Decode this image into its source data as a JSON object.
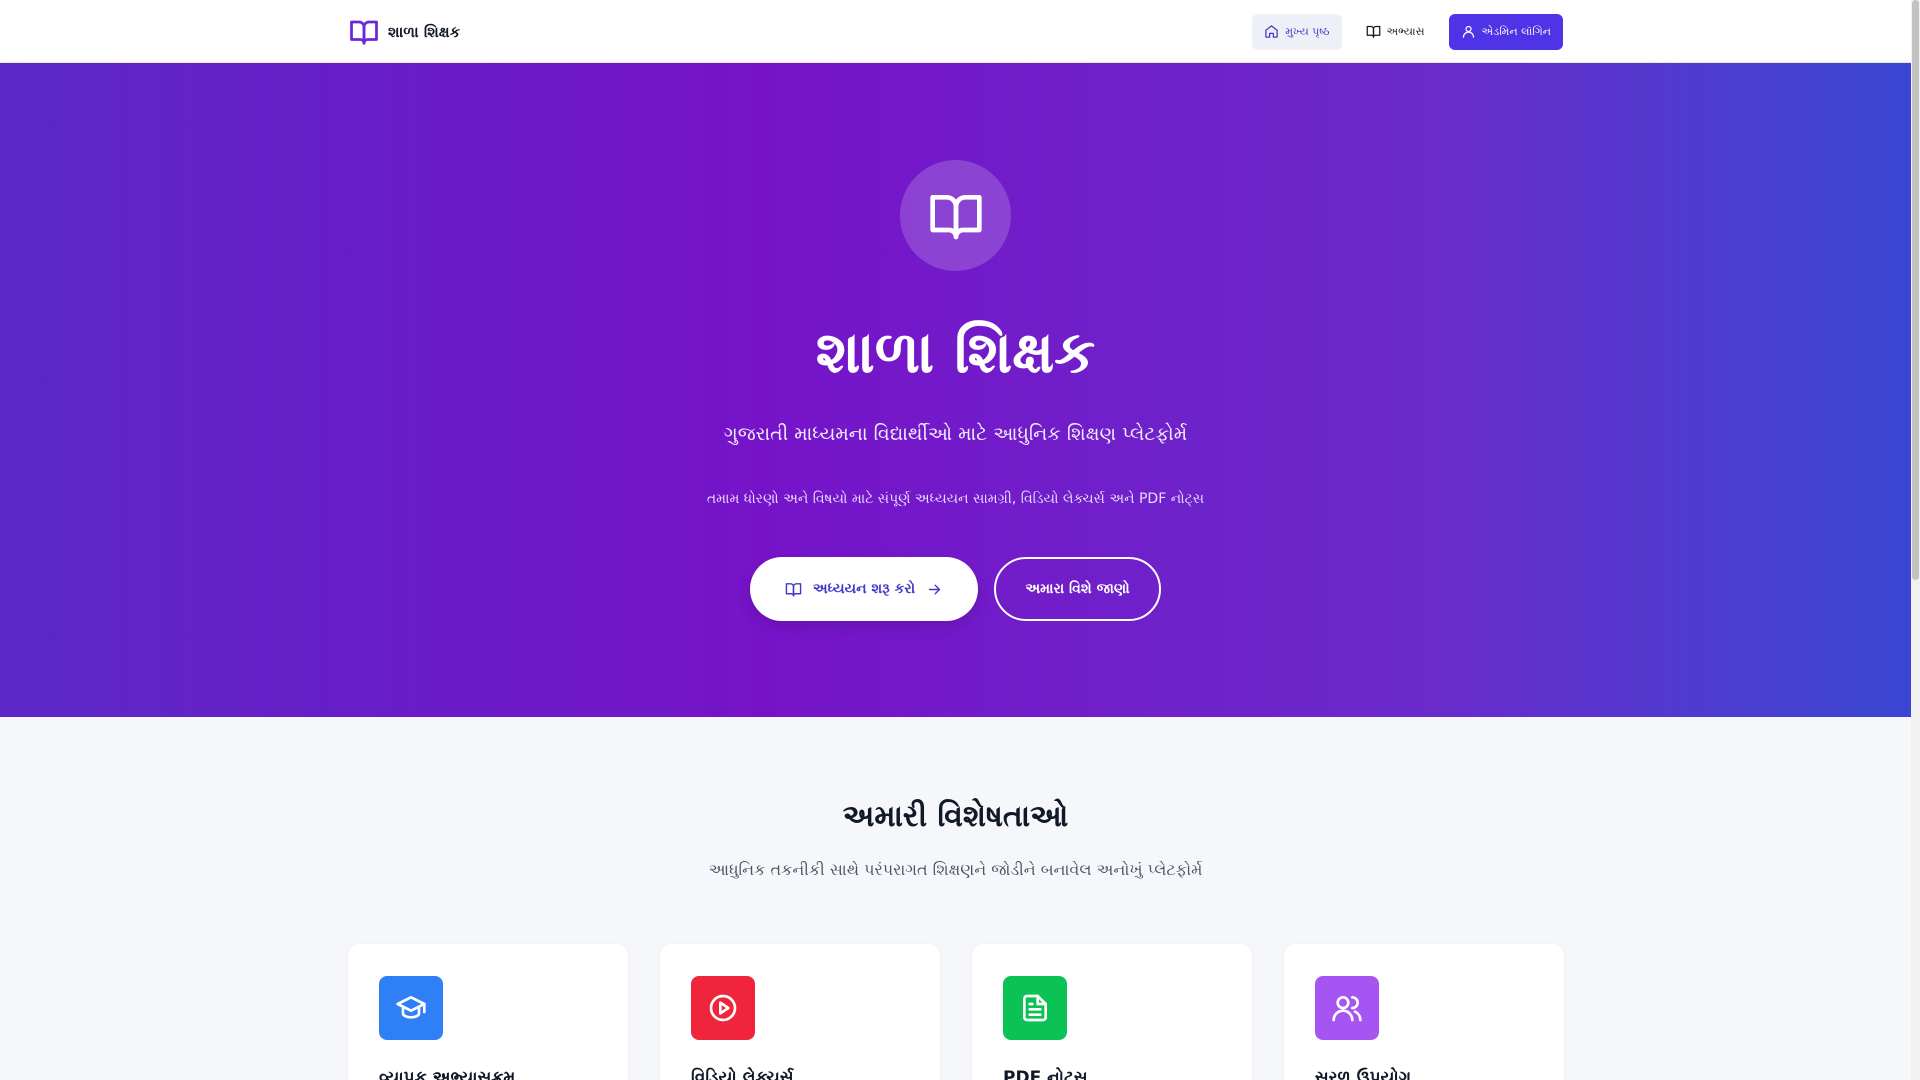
{
  "brand": {
    "name": "શાળા શિક્ષક",
    "icon": "open-book-icon",
    "color": "#6d28d9"
  },
  "nav": {
    "home": "મુખ્ય પૃષ્ઠ",
    "study": "અભ્યાસ",
    "admin": "એડમિન લૉગિન"
  },
  "hero": {
    "title": "શાળા શિક્ષક",
    "subtitle": "ગુજરાતી માધ્યમના વિદ્યાર્થીઓ માટે આધુનિક શિક્ષણ પ્લેટફોર્મ",
    "description": "તમામ ધોરણો અને વિષયો માટે સંપૂર્ણ અધ્યયન સામગ્રી, વિડિયો લેક્ચર્સ અને PDF નોટ્સ",
    "start_button": "અધ્યયન શરૂ કરો",
    "about_button": "અમારા વિશે જાણો"
  },
  "features": {
    "title": "અમારી વિશેષતાઓ",
    "subtitle": "આધુનિક તકનીકી સાથે પરંપરાગત શિક્ષણને જોડીને બનાવેલ અનોખું પ્લેટફોર્મ",
    "cards": [
      {
        "title": "વ્યાપક અભ્યાસક્રમ",
        "icon": "graduation-cap-icon",
        "color": "#2f80f6"
      },
      {
        "title": "વિડિયો લેક્ચર્સ",
        "icon": "play-circle-icon",
        "color": "#f0243a"
      },
      {
        "title": "PDF નોટ્સ",
        "icon": "document-icon",
        "color": "#0bc255"
      },
      {
        "title": "સરળ ઉપયોગ",
        "icon": "users-icon",
        "color": "#a755f2"
      }
    ]
  }
}
